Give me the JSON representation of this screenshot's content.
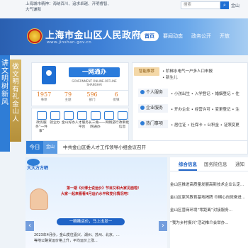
{
  "top": {
    "slogan_line1": "上海城市精神：海纳百川、追求卓越、开明睿智、",
    "slogan_line2": "大气谦和",
    "search_placeholder": "搜索",
    "region_label": "金山"
  },
  "header": {
    "title": "上海市金山区人民政府",
    "domain": "www.jinshan.gov.cn",
    "nav": [
      "首页",
      "要闻动态",
      "政务公开",
      "开放"
    ]
  },
  "side": {
    "left_banner": "讲文明树新风",
    "right_banner": "做文明有礼金山人"
  },
  "portal": {
    "name": "一网通办",
    "subtitle": "GOVERNMENT ONLINE-OFFLINE SHANGHAI"
  },
  "stats": [
    {
      "value": "1957",
      "label": "事项"
    },
    {
      "value": "79",
      "label": "主题"
    },
    {
      "value": "596",
      "label": "部门"
    },
    {
      "value": "6",
      "label": "街镇"
    }
  ],
  "services": [
    {
      "label": "政务服务“一件事”"
    },
    {
      "label": "就企办"
    },
    {
      "label": "金山好办"
    },
    {
      "label": "人才服务平台"
    },
    {
      "label": "长三角一网通办"
    },
    {
      "label": "一网畅游"
    },
    {
      "label": "行政审批信息"
    }
  ],
  "panel": {
    "recommend_label": "智能推荐",
    "recommend_item1": "• 阶梯水电气一户多人口申报",
    "recommend_item2": "• 新生儿",
    "rows": [
      {
        "head": "个人服务",
        "links": "• 小孩出生 • 入学登记 • 婚姻登记 • 住"
      },
      {
        "head": "企业服务",
        "links": "• 开办企业 • 经营许可 • 变更登记 • 注"
      },
      {
        "head": "热门事项",
        "links": "• 居住证 • 社保卡 • 公积金 • 证照变更"
      }
    ]
  },
  "today": {
    "tag": "今日",
    "location": "金山",
    "headline": "中共金山区委人才工作领导小组会议召开"
  },
  "promo": {
    "head": "大大方方晒",
    "line1": "第一期《价博士说运价》节目又和大家见面啦!",
    "line2": "大家一起来看看4月运价水平和变化情况吧!",
    "line3": "",
    "ribbon": "一瞧瞧运价，马上出发一",
    "line4": "2023年4月份，金山发往嘉兴、湖州、苏州、北京、...",
    "line5": "等地公路货运价格上升，平均运价上涨..."
  },
  "news": {
    "tabs": [
      "综合信息",
      "国务院信息",
      "通知"
    ],
    "items": [
      "金山区推进高质量发展高新技术企业认定...",
      "金山区家风教育基地揭牌 巾帼心向党奋进...",
      "金山区营商环境“零距离”对接服务...",
      "“我为乡村振兴”活动推介会举办..."
    ]
  },
  "arrows": {
    "left": "‹",
    "right": "›"
  }
}
